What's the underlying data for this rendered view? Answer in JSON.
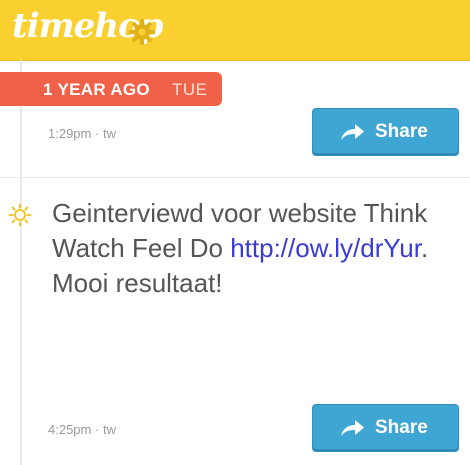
{
  "app": {
    "logo_text": "timehop"
  },
  "icons": {
    "settings": "gear-icon",
    "share": "arrow-share-icon",
    "post_marker": "sun-icon"
  },
  "colors": {
    "header_bg": "#f9d030",
    "badge_bg": "#f0614a",
    "share_bg": "#3fa6d4",
    "link": "#3a3ad6"
  },
  "date_header": {
    "ago_label": "1 YEAR AGO",
    "weekday": "TUE"
  },
  "entries": [
    {
      "time": "1:29pm",
      "source": "tw",
      "share_label": "Share"
    },
    {
      "text_before": "Geinterviewd voor website Think Watch Feel Do ",
      "link": "http://ow.ly/drYur",
      "text_after": ". Mooi resultaat!",
      "time": "4:25pm",
      "source": "tw",
      "share_label": "Share"
    }
  ]
}
